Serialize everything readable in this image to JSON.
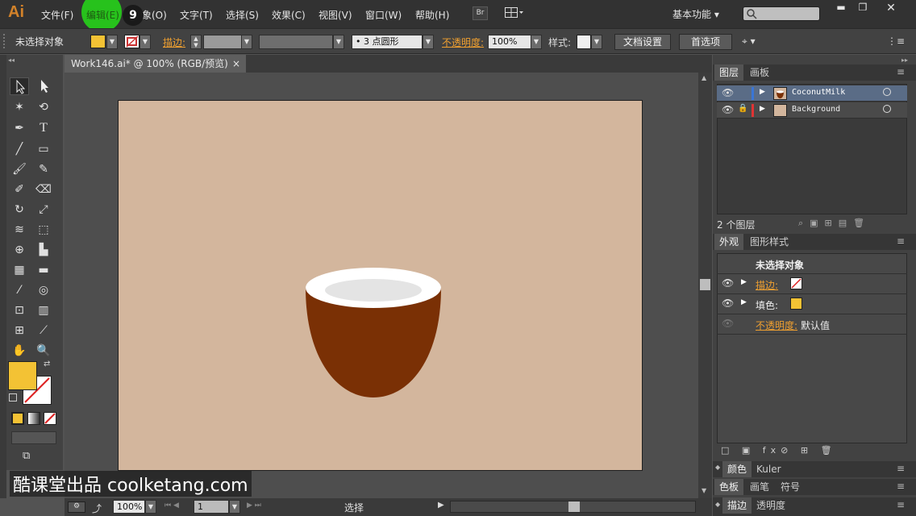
{
  "app": {
    "logo": "Ai",
    "menu": [
      "文件(F)",
      "编辑(E)",
      "象(O)",
      "文字(T)",
      "选择(S)",
      "效果(C)",
      "视图(V)",
      "窗口(W)",
      "帮助(H)"
    ],
    "bridge_label": "Br",
    "workspace": "基本功能",
    "step_number": "9",
    "highlight_color": "#27c21c"
  },
  "control": {
    "selection_label": "未选择对象",
    "fill_color": "#f3c234",
    "stroke_label": "描边:",
    "brush_label": "• 3 点圆形",
    "opacity_label": "不透明度:",
    "opacity_value": "100%",
    "style_label": "样式:",
    "doc_setup": "文档设置",
    "prefs": "首选项"
  },
  "document": {
    "tab_title": "Work146.ai* @ 100% (RGB/预览)",
    "close_glyph": "×",
    "artboard_color": "#d3b69d",
    "coconut_shell_color": "#7a3005",
    "coconut_rim_color": "#ffffff",
    "coconut_meat_color": "#e4e4e4"
  },
  "status": {
    "zoom": "100%",
    "page": "1",
    "tool": "选择"
  },
  "layers_panel": {
    "tabs": [
      "图层",
      "画板"
    ],
    "layers": [
      {
        "name": "CoconutMilk",
        "color": "#3a76d6"
      },
      {
        "name": "Background",
        "color": "#e03434"
      }
    ],
    "count": "2 个图层"
  },
  "appearance_panel": {
    "tabs": [
      "外观",
      "图形样式"
    ],
    "title": "未选择对象",
    "stroke_label": "描边:",
    "fill_label": "填色:",
    "opacity_label": "不透明度:",
    "opacity_value": "默认值"
  },
  "collapsed_panels": [
    {
      "tabs": [
        "颜色",
        "Kuler"
      ]
    },
    {
      "tabs": [
        "色板",
        "画笔",
        "符号"
      ]
    },
    {
      "tabs": [
        "描边",
        "透明度"
      ]
    }
  ],
  "watermark": "酷课堂出品 coolketang.com"
}
